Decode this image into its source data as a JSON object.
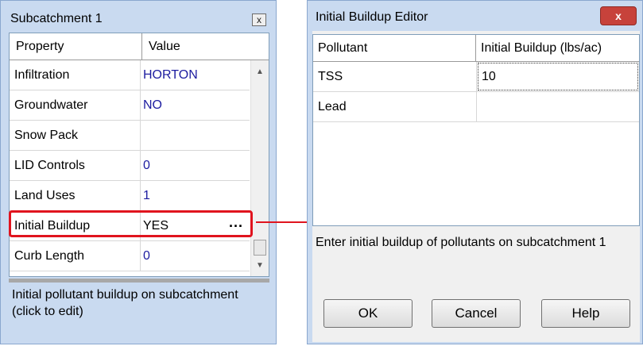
{
  "property_panel": {
    "title": "Subcatchment 1",
    "close_icon": "x",
    "columns": {
      "property": "Property",
      "value": "Value"
    },
    "rows": [
      {
        "name": "Infiltration",
        "value": "HORTON"
      },
      {
        "name": "Groundwater",
        "value": "NO"
      },
      {
        "name": "Snow Pack",
        "value": ""
      },
      {
        "name": "LID Controls",
        "value": "0"
      },
      {
        "name": "Land Uses",
        "value": "1"
      },
      {
        "name": "Initial Buildup",
        "value": "YES",
        "ellipsis": "..."
      },
      {
        "name": "Curb Length",
        "value": "0"
      }
    ],
    "description": "Initial pollutant buildup on subcatchment (click to edit)",
    "highlight_color": "#e0141e"
  },
  "dialog": {
    "title": "Initial Buildup Editor",
    "close_icon": "x",
    "columns": {
      "pollutant": "Pollutant",
      "initial_buildup": "Initial Buildup (lbs/ac)"
    },
    "rows": [
      {
        "pollutant": "TSS",
        "value": "10"
      },
      {
        "pollutant": "Lead",
        "value": ""
      }
    ],
    "message": "Enter initial buildup of pollutants on subcatchment 1",
    "buttons": {
      "ok": "OK",
      "cancel": "Cancel",
      "help": "Help"
    }
  },
  "colors": {
    "panel_bg": "#c9daf0",
    "value_text": "#1c1ca0",
    "close_button": "#c7423b"
  }
}
